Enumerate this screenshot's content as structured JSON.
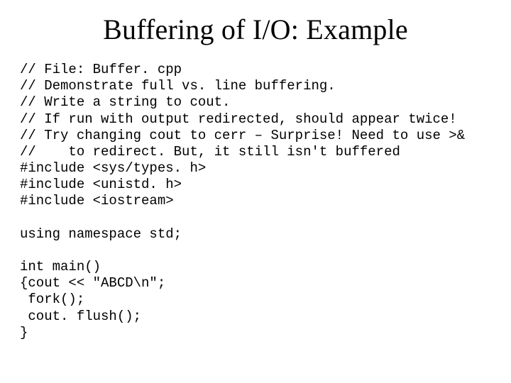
{
  "title": "Buffering of I/O: Example",
  "code": {
    "c01": "// File: Buffer. cpp",
    "c02": "// Demonstrate full vs. line buffering.",
    "c03": "// Write a string to cout.",
    "c04": "// If run with output redirected, should appear twice!",
    "c05": "// Try changing cout to cerr – Surprise! Need to use >&",
    "c06": "//    to redirect. But, it still isn't buffered",
    "c07": "#include <sys/types. h>",
    "c08": "#include <unistd. h>",
    "c09": "#include <iostream>",
    "c10": "",
    "c11": "using namespace std;",
    "c12": "",
    "c13": "int main()",
    "c14": "{cout << \"ABCD\\n\";",
    "c15": " fork();",
    "c16": " cout. flush();",
    "c17": "}"
  }
}
